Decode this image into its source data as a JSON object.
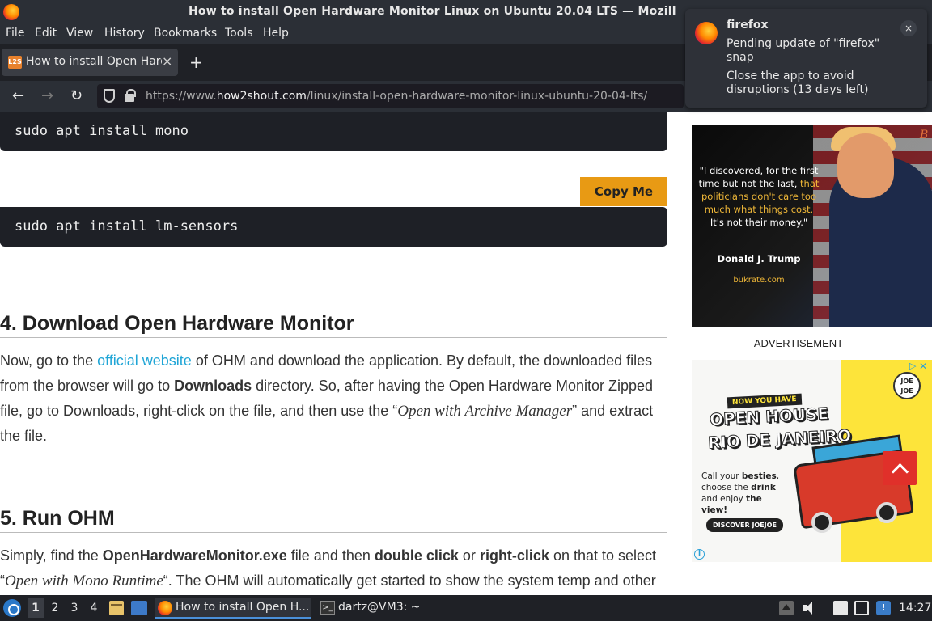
{
  "window": {
    "title": "How to install Open Hardware Monitor Linux on Ubuntu 20.04 LTS — Mozill"
  },
  "menu": [
    "File",
    "Edit",
    "View",
    "History",
    "Bookmarks",
    "Tools",
    "Help"
  ],
  "tab": {
    "favicon_text": "L2S",
    "label": "How to install Open Hard",
    "close": "×",
    "new_tab": "+"
  },
  "nav": {
    "back": "←",
    "forward": "→",
    "reload": "↻",
    "url_prefix": "https://www.",
    "url_domain": "how2shout.com",
    "url_path": "/linux/install-open-hardware-monitor-linux-ubuntu-20-04-lts/"
  },
  "content": {
    "code1": "sudo apt install mono",
    "copy_button": "Copy Me",
    "code2": "sudo apt install lm-sensors",
    "section4_heading": "4. Download Open Hardware Monitor",
    "section4_p": {
      "t1": "Now, go to the ",
      "link": "official website",
      "t2": " of OHM and download the application. By default, the downloaded files from the browser will go to ",
      "b1": "Downloads",
      "t3": " directory.  So, after having the Open Hardware Monitor Zipped file, go to Downloads, right-click on the file, and then use the “",
      "i1": "Open with Archive Manager",
      "t4": "” and extract the file."
    },
    "section5_heading": "5. Run OHM",
    "section5_p": {
      "t1": "Simply, find the ",
      "b1": "OpenHardwareMonitor.exe",
      "t2": " file and then ",
      "b2": "double click",
      "t3": " or ",
      "b3": "right-click",
      "t4": " on that to select “",
      "i1": "Open with Mono Runtime",
      "t5": "“. The OHM will automatically get started to show the system temp and other"
    }
  },
  "ad1": {
    "quote_a": "\"I discovered, for the first time but not the last, ",
    "quote_hl": "that politicians don't care too much what things cost.",
    "quote_b": " It's not their money.\"",
    "author": "Donald J. Trump",
    "site": "bukrate.com",
    "brand": "B"
  },
  "ad_label": "ADVERTISEMENT",
  "ad2": {
    "adchoice_glyph": "▷",
    "adchoice_close": "✕",
    "badge": "JOE JOE",
    "banner": "NOW YOU HAVE",
    "headline1": "OPEN HOUSE",
    "headline2": "RIO DE JANEIRO",
    "tag_1": "Call your ",
    "tag_b1": "besties",
    "tag_2": ", choose the ",
    "tag_b2": "drink",
    "tag_3": " and enjoy ",
    "tag_b3": "the view!",
    "cta": "DISCOVER JOEJOE",
    "info": "i"
  },
  "notification": {
    "app": "firefox",
    "message1": "Pending update of \"firefox\" snap",
    "message2": "Close the app to avoid disruptions (13 days left)",
    "close": "×"
  },
  "taskbar": {
    "workspaces": [
      "1",
      "2",
      "3",
      "4"
    ],
    "active_workspace": "1",
    "task_firefox": "How to install Open H...",
    "task_terminal": "dartz@VM3: ~",
    "terminal_glyph": ">_",
    "info_glyph": "!",
    "clock": "14:27"
  },
  "colors": {
    "accent_link": "#1fa5d6",
    "copy_button": "#e89a14",
    "scroll_top": "#e0302a"
  }
}
